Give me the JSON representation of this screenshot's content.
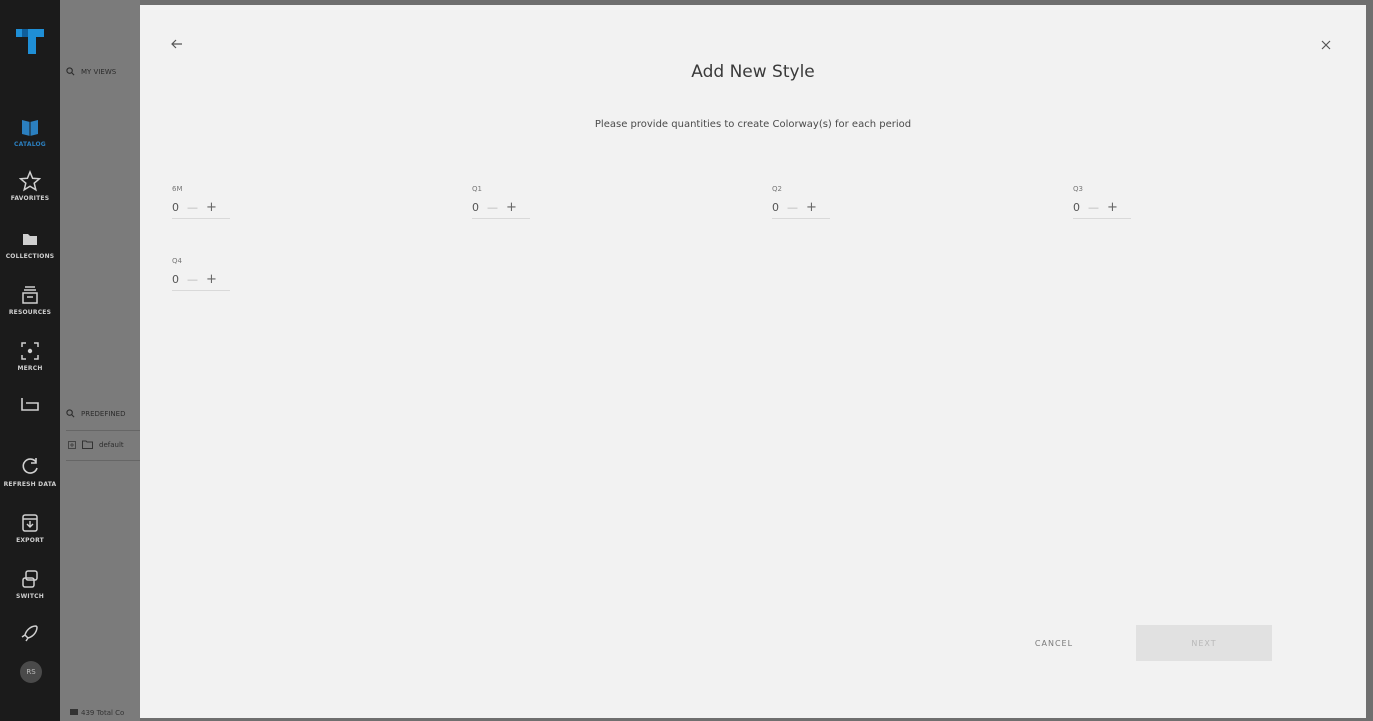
{
  "nav": {
    "items": [
      {
        "label": "CATALOG",
        "icon": "catalog-icon"
      },
      {
        "label": "FAVORITES",
        "icon": "star-icon"
      },
      {
        "label": "COLLECTIONS",
        "icon": "folder-icon"
      },
      {
        "label": "RESOURCES",
        "icon": "resources-icon"
      },
      {
        "label": "MERCH",
        "icon": "merch-icon"
      },
      {
        "label": "",
        "icon": "basket-icon"
      },
      {
        "label": "REFRESH DATA",
        "icon": "refresh-icon"
      },
      {
        "label": "EXPORT",
        "icon": "export-icon"
      },
      {
        "label": "SWITCH",
        "icon": "switch-icon"
      },
      {
        "label": "",
        "icon": "rocket-icon"
      }
    ],
    "avatar": "RS",
    "accent": "#2b7fbf"
  },
  "side": {
    "my_views": "MY VIEWS",
    "predefined": "PREDEFINED",
    "default_item": "default",
    "footer": "439 Total Co"
  },
  "modal": {
    "title": "Add New Style",
    "subtitle": "Please provide quantities to create Colorway(s) for each period",
    "periods": [
      {
        "label": "6M",
        "value": "0"
      },
      {
        "label": "Q1",
        "value": "0"
      },
      {
        "label": "Q2",
        "value": "0"
      },
      {
        "label": "Q3",
        "value": "0"
      },
      {
        "label": "Q4",
        "value": "0"
      }
    ],
    "minus": "—",
    "plus": "+",
    "cancel": "CANCEL",
    "next": "NEXT"
  }
}
